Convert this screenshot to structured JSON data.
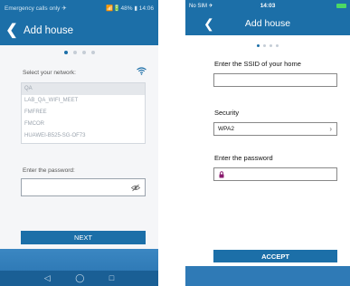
{
  "colors": {
    "primary": "#1c6fa8",
    "bottom_bar": "#2f7ab6",
    "battery": "#4cd964",
    "lock": "#8a1b6e"
  },
  "android": {
    "status_left": "Emergency calls only ✈",
    "status_right": "📶🔋48% ▮ 14:06",
    "title": "Add house",
    "network_label": "Select your network:",
    "networks": [
      "QA",
      "LAB_QA_WIFI_MEET",
      "FMFREE",
      "FMCOR",
      "HUAWEI-B525-SG-OF73"
    ],
    "selected_network": "QA",
    "password_label": "Enter the password:",
    "password_value": "",
    "next_label": "NEXT",
    "nav_icons": [
      "back-icon",
      "home-icon",
      "recents-icon"
    ]
  },
  "ios": {
    "carrier": "No SIM ✈",
    "time": "14:03",
    "title": "Add house",
    "ssid_label": "Enter the SSID of your home",
    "ssid_value": "",
    "security_label": "Security",
    "security_value": "WPA2",
    "password_label": "Enter the password",
    "password_value": "",
    "accept_label": "ACCEPT"
  }
}
